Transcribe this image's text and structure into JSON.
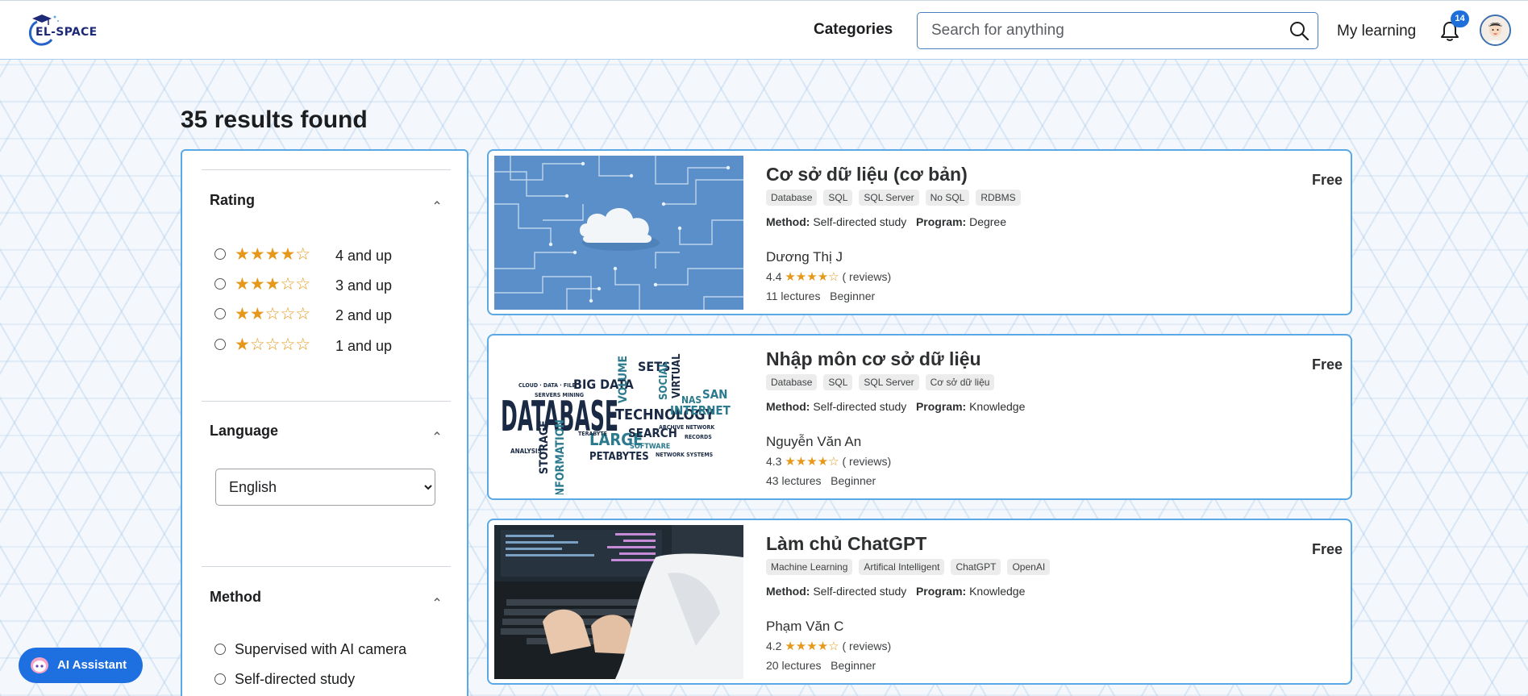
{
  "header": {
    "logo_text": "EL-SPACE",
    "categories_label": "Categories",
    "search_placeholder": "Search for anything",
    "my_learning_label": "My learning",
    "notification_count": "14"
  },
  "results_title": "35 results found",
  "filters": {
    "rating": {
      "title": "Rating",
      "options": [
        {
          "stars": "★★★★☆",
          "label": "4 and up"
        },
        {
          "stars": "★★★☆☆",
          "label": "3 and up"
        },
        {
          "stars": "★★☆☆☆",
          "label": "2 and up"
        },
        {
          "stars": "★☆☆☆☆",
          "label": "1 and up"
        }
      ]
    },
    "language": {
      "title": "Language",
      "selected": "English"
    },
    "method": {
      "title": "Method",
      "options": [
        "Supervised with AI camera",
        "Self-directed study"
      ]
    }
  },
  "courses": [
    {
      "title": "Cơ sở dữ liệu (cơ bản)",
      "price": "Free",
      "tags": [
        "Database",
        "SQL",
        "SQL Server",
        "No SQL",
        "RDBMS"
      ],
      "method_label": "Method:",
      "method": "Self-directed study",
      "program_label": "Program:",
      "program": "Degree",
      "instructor": "Dương Thị J",
      "rating": "4.4",
      "stars": "★★★★☆",
      "reviews": "( reviews)",
      "lectures": "11 lectures",
      "level": "Beginner"
    },
    {
      "title": "Nhập môn cơ sở dữ liệu",
      "price": "Free",
      "tags": [
        "Database",
        "SQL",
        "SQL Server",
        "Cơ sở dữ liệu"
      ],
      "method_label": "Method:",
      "method": "Self-directed study",
      "program_label": "Program:",
      "program": "Knowledge",
      "instructor": "Nguyễn Văn An",
      "rating": "4.3",
      "stars": "★★★★☆",
      "reviews": "( reviews)",
      "lectures": "43 lectures",
      "level": "Beginner"
    },
    {
      "title": "Làm chủ ChatGPT",
      "price": "Free",
      "tags": [
        "Machine Learning",
        "Artifical Intelligent",
        "ChatGPT",
        "OpenAI"
      ],
      "method_label": "Method:",
      "method": "Self-directed study",
      "program_label": "Program:",
      "program": "Knowledge",
      "instructor": "Phạm Văn C",
      "rating": "4.2",
      "stars": "★★★★☆",
      "reviews": "( reviews)",
      "lectures": "20 lectures",
      "level": "Beginner"
    }
  ],
  "thumb_word_cloud": {
    "main": "DATABASE",
    "words": [
      "BIG DATA",
      "SETS",
      "VOLUME",
      "TECHNOLOGY",
      "SOCIAL",
      "VIRTUAL",
      "NAS",
      "SAN",
      "INTERNET",
      "LARGE",
      "SEARCH",
      "STORAGE",
      "INFORMATION",
      "PETABYTES",
      "SOFTWARE",
      "ANALYSIS"
    ]
  },
  "ai_assistant_label": "AI Assistant",
  "colors": {
    "accent": "#1e6fe0",
    "card_border": "#5aa9e6",
    "star": "#e59819"
  }
}
